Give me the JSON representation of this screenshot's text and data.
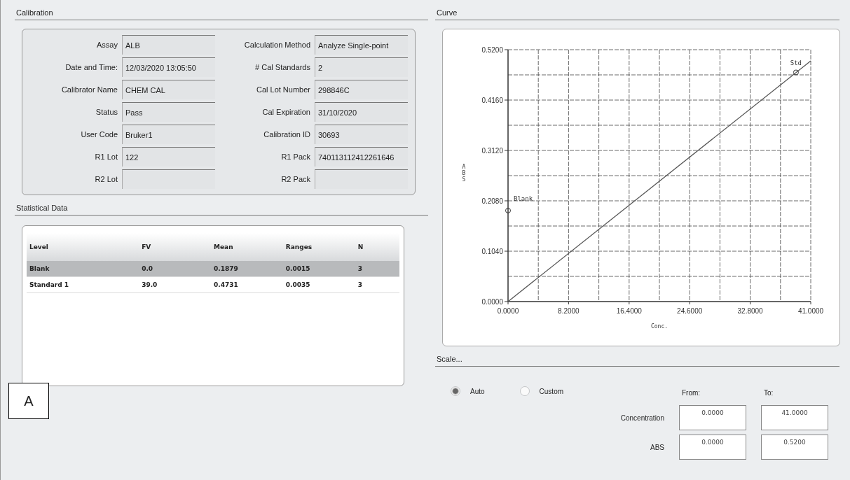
{
  "calibration": {
    "title": "Calibration",
    "fields": [
      {
        "label": "Assay",
        "value": "ALB"
      },
      {
        "label": "Calculation Method",
        "value": "Analyze Single-point"
      },
      {
        "label": "Date and Time:",
        "value": "12/03/2020 13:05:50"
      },
      {
        "label": "# Cal Standards",
        "value": "2"
      },
      {
        "label": "Calibrator Name",
        "value": "CHEM CAL"
      },
      {
        "label": "Cal Lot Number",
        "value": "298846C"
      },
      {
        "label": "Status",
        "value": "Pass"
      },
      {
        "label": "Cal Expiration",
        "value": "31/10/2020"
      },
      {
        "label": "User Code",
        "value": "Bruker1"
      },
      {
        "label": "Calibration ID",
        "value": "30693"
      },
      {
        "label": "R1 Lot",
        "value": "122"
      },
      {
        "label": "R1 Pack",
        "value": "740113112412261646"
      },
      {
        "label": "R2 Lot"
      },
      {
        "label": "R2 Pack"
      }
    ]
  },
  "statistical_data": {
    "title": "Statistical Data",
    "columns": [
      "Level",
      "FV",
      "Mean",
      "Ranges",
      "N"
    ],
    "rows": [
      {
        "cells": [
          "Blank",
          "0.0",
          "0.1879",
          "0.0015",
          "3"
        ],
        "selected": true
      },
      {
        "cells": [
          "Standard 1",
          "39.0",
          "0.4731",
          "0.0035",
          "3"
        ],
        "selected": false
      }
    ]
  },
  "curve": {
    "title": "Curve",
    "chart_data": {
      "type": "line",
      "xlabel": "Conc.",
      "ylabel": "ABS",
      "x": [
        0,
        41
      ],
      "grid": true,
      "series": [
        {
          "color": "#555555",
          "values": [
            0,
            0.497
          ]
        }
      ],
      "xlim": [
        0,
        41
      ],
      "ylim": [
        0,
        0.52
      ],
      "xticks": [
        {
          "value": 0,
          "label": "0.0000"
        },
        {
          "value": 8.2,
          "label": "8.2000"
        },
        {
          "value": 16.4,
          "label": "16.4000"
        },
        {
          "value": 24.6,
          "label": "24.6000"
        },
        {
          "value": 32.8,
          "label": "32.8000"
        },
        {
          "value": 41,
          "label": "41.0000"
        }
      ],
      "yticks": [
        {
          "value": 0,
          "label": "0.0000"
        },
        {
          "value": 0.104,
          "label": "0.1040"
        },
        {
          "value": 0.208,
          "label": "0.2080"
        },
        {
          "value": 0.312,
          "label": "0.3120"
        },
        {
          "value": 0.416,
          "label": "0.4160"
        },
        {
          "value": 0.52,
          "label": "0.5200"
        }
      ],
      "annotations": [
        {
          "text": "Blank",
          "x": 0,
          "y": 0.1879
        },
        {
          "text": "Std",
          "x": 39,
          "y": 0.4731
        }
      ]
    }
  },
  "scale": {
    "title": "Scale...",
    "options": [
      {
        "label": "Auto",
        "selected": true
      },
      {
        "label": "Custom",
        "selected": false
      }
    ],
    "from_label": "From:",
    "to_label": "To:",
    "ranges": [
      {
        "label": "Concentration",
        "from": "0.0000",
        "to": "41.0000"
      },
      {
        "label": "ABS",
        "from": "0.0000",
        "to": "0.5200"
      }
    ]
  },
  "panel_label": "A"
}
